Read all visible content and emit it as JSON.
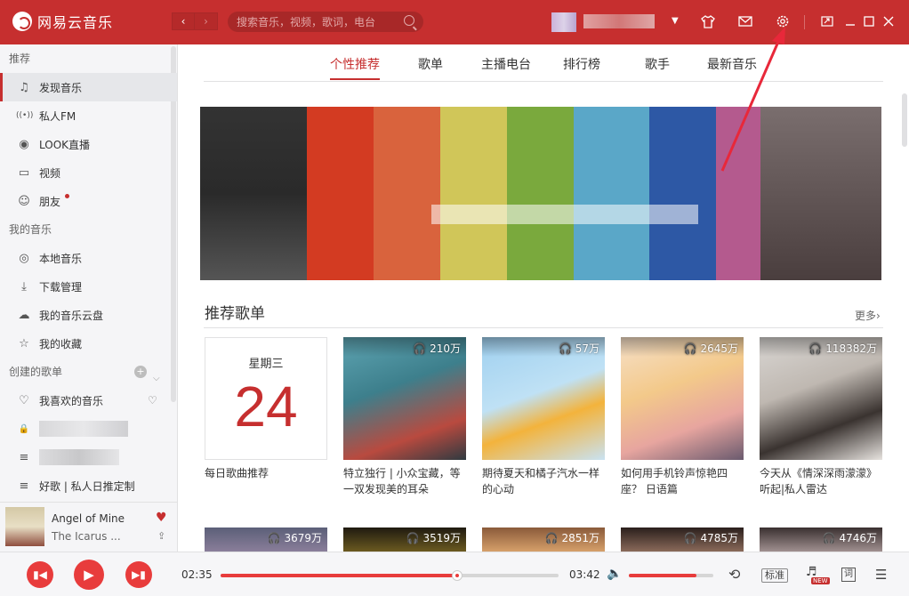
{
  "app": {
    "name": "网易云音乐"
  },
  "header": {
    "search_placeholder": "搜索音乐，视频，歌词，电台",
    "nav_back": "‹",
    "nav_forward": "›"
  },
  "sidebar": {
    "sections": [
      {
        "title": "推荐",
        "items": [
          {
            "label": "发现音乐",
            "icon": "♫"
          },
          {
            "label": "私人FM",
            "icon": "((•))"
          },
          {
            "label": "LOOK直播",
            "icon": "◉"
          },
          {
            "label": "视频",
            "icon": "▭"
          },
          {
            "label": "朋友",
            "icon": "☺"
          }
        ]
      },
      {
        "title": "我的音乐",
        "items": [
          {
            "label": "本地音乐",
            "icon": "◎"
          },
          {
            "label": "下载管理",
            "icon": "⤓"
          },
          {
            "label": "我的音乐云盘",
            "icon": "☁"
          },
          {
            "label": "我的收藏",
            "icon": "☆"
          }
        ]
      },
      {
        "title": "创建的歌单",
        "items": [
          {
            "label": "我喜欢的音乐",
            "icon": "♡"
          },
          {
            "label": "",
            "icon": "🔒"
          },
          {
            "label": "",
            "icon": "≡"
          },
          {
            "label": "好歌 | 私人日推定制",
            "icon": "≡"
          }
        ]
      }
    ]
  },
  "now_playing": {
    "title": "Angel of Mine",
    "artist": "The Icarus ..."
  },
  "tabs": [
    "个性推荐",
    "歌单",
    "主播电台",
    "排行榜",
    "歌手",
    "最新音乐"
  ],
  "active_tab": "个性推荐",
  "recommend": {
    "title": "推荐歌单",
    "more": "更多›",
    "daily": {
      "weekday": "星期三",
      "day": "24",
      "title": "每日歌曲推荐"
    },
    "playlists": [
      {
        "plays": "210万",
        "title": "特立独行 | 小众宝藏，等一双发现美的耳朵"
      },
      {
        "plays": "57万",
        "title": "期待夏天和橘子汽水一样的心动"
      },
      {
        "plays": "2645万",
        "title": "如何用手机铃声惊艳四座？ 日语篇"
      },
      {
        "plays": "118382万",
        "title": "今天从《情深深雨濛濛》听起|私人雷达"
      }
    ],
    "row2_plays": [
      "3679万",
      "3519万",
      "2851万",
      "4785万",
      "4746万"
    ]
  },
  "player": {
    "current_time": "02:35",
    "total_time": "03:42",
    "progress": 0.7,
    "volume": 0.8,
    "quality": "标准",
    "new_badge": "NEW",
    "lyric": "词"
  },
  "colors": {
    "brand": "#c62f2f",
    "accent": "#e83c3c"
  }
}
